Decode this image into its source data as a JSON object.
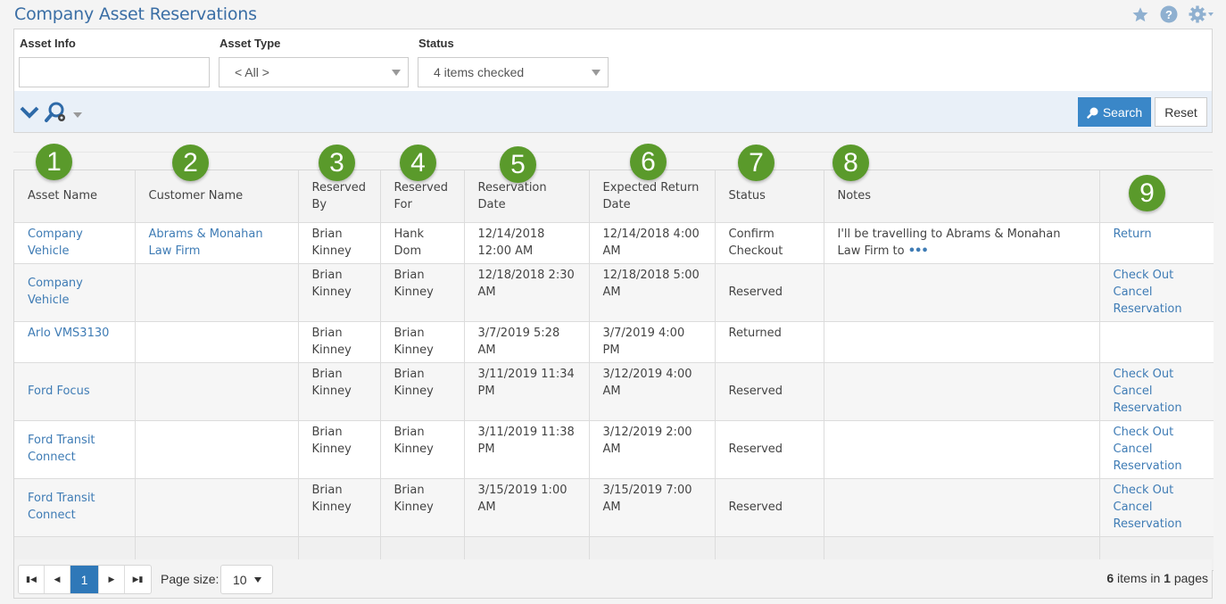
{
  "header": {
    "title": "Company Asset Reservations",
    "icons": [
      "star-icon",
      "help-icon",
      "gear-icon"
    ]
  },
  "filters": {
    "asset_info": {
      "label": "Asset Info",
      "value": ""
    },
    "asset_type": {
      "label": "Asset Type",
      "value": "< All >"
    },
    "status": {
      "label": "Status",
      "value": "4 items checked"
    },
    "search_label": "Search",
    "reset_label": "Reset"
  },
  "colors": {
    "title": "#3a6ea5",
    "link": "#3f7cb5",
    "primary_button": "#3a87c8",
    "badge": "#5a9a2b",
    "toolbar_bg": "#e9f0f8"
  },
  "grid": {
    "columns": [
      {
        "label": "Asset Name",
        "badge": "1"
      },
      {
        "label": "Customer Name",
        "badge": "2"
      },
      {
        "label": "Reserved By",
        "badge": "3"
      },
      {
        "label": "Reserved For",
        "badge": "4"
      },
      {
        "label": "Reservation Date",
        "badge": "5"
      },
      {
        "label": "Expected Return Date",
        "badge": "6"
      },
      {
        "label": "Status",
        "badge": "7"
      },
      {
        "label": "Notes",
        "badge": "8"
      },
      {
        "label": "",
        "badge": "9"
      }
    ],
    "rows": [
      {
        "asset": "Company Vehicle",
        "customer": "Abrams & Monahan Law Firm",
        "reserved_by": "Brian Kinney",
        "reserved_for": "Hank Dom",
        "reservation_date": "12/14/2018 12:00 AM",
        "return_date": "12/14/2018 4:00 AM",
        "status": "Confirm Checkout",
        "notes": "I'll be travelling to Abrams & Monahan Law Firm to",
        "notes_more": "•••",
        "actions": [
          "Return"
        ]
      },
      {
        "asset": "Company Vehicle",
        "customer": "",
        "reserved_by": "Brian Kinney",
        "reserved_for": "Brian Kinney",
        "reservation_date": "12/18/2018 2:30 AM",
        "return_date": "12/18/2018 5:00 AM",
        "status": "Reserved",
        "notes": "",
        "notes_more": "",
        "actions": [
          "Check Out",
          "Cancel Reservation"
        ]
      },
      {
        "asset": "Arlo VMS3130",
        "customer": "",
        "reserved_by": "Brian Kinney",
        "reserved_for": "Brian Kinney",
        "reservation_date": "3/7/2019 5:28 AM",
        "return_date": "3/7/2019 4:00 PM",
        "status": "Returned",
        "notes": "",
        "notes_more": "",
        "actions": []
      },
      {
        "asset": "Ford Focus",
        "customer": "",
        "reserved_by": "Brian Kinney",
        "reserved_for": "Brian Kinney",
        "reservation_date": "3/11/2019 11:34 PM",
        "return_date": "3/12/2019 4:00 AM",
        "status": "Reserved",
        "notes": "",
        "notes_more": "",
        "actions": [
          "Check Out",
          "Cancel Reservation"
        ]
      },
      {
        "asset": "Ford Transit Connect",
        "customer": "",
        "reserved_by": "Brian Kinney",
        "reserved_for": "Brian Kinney",
        "reservation_date": "3/11/2019 11:38 PM",
        "return_date": "3/12/2019 2:00 AM",
        "status": "Reserved",
        "notes": "",
        "notes_more": "",
        "actions": [
          "Check Out",
          "Cancel Reservation"
        ]
      },
      {
        "asset": "Ford Transit Connect",
        "customer": "",
        "reserved_by": "Brian Kinney",
        "reserved_for": "Brian Kinney",
        "reservation_date": "3/15/2019 1:00 AM",
        "return_date": "3/15/2019 7:00 AM",
        "status": "Reserved",
        "notes": "",
        "notes_more": "",
        "actions": [
          "Check Out",
          "Cancel Reservation"
        ]
      }
    ]
  },
  "pager": {
    "current_page": "1",
    "page_size_label": "Page size:",
    "page_size": "10",
    "total_items": "6",
    "items_in_text": "items in",
    "total_pages": "1",
    "pages_text": "pages"
  }
}
